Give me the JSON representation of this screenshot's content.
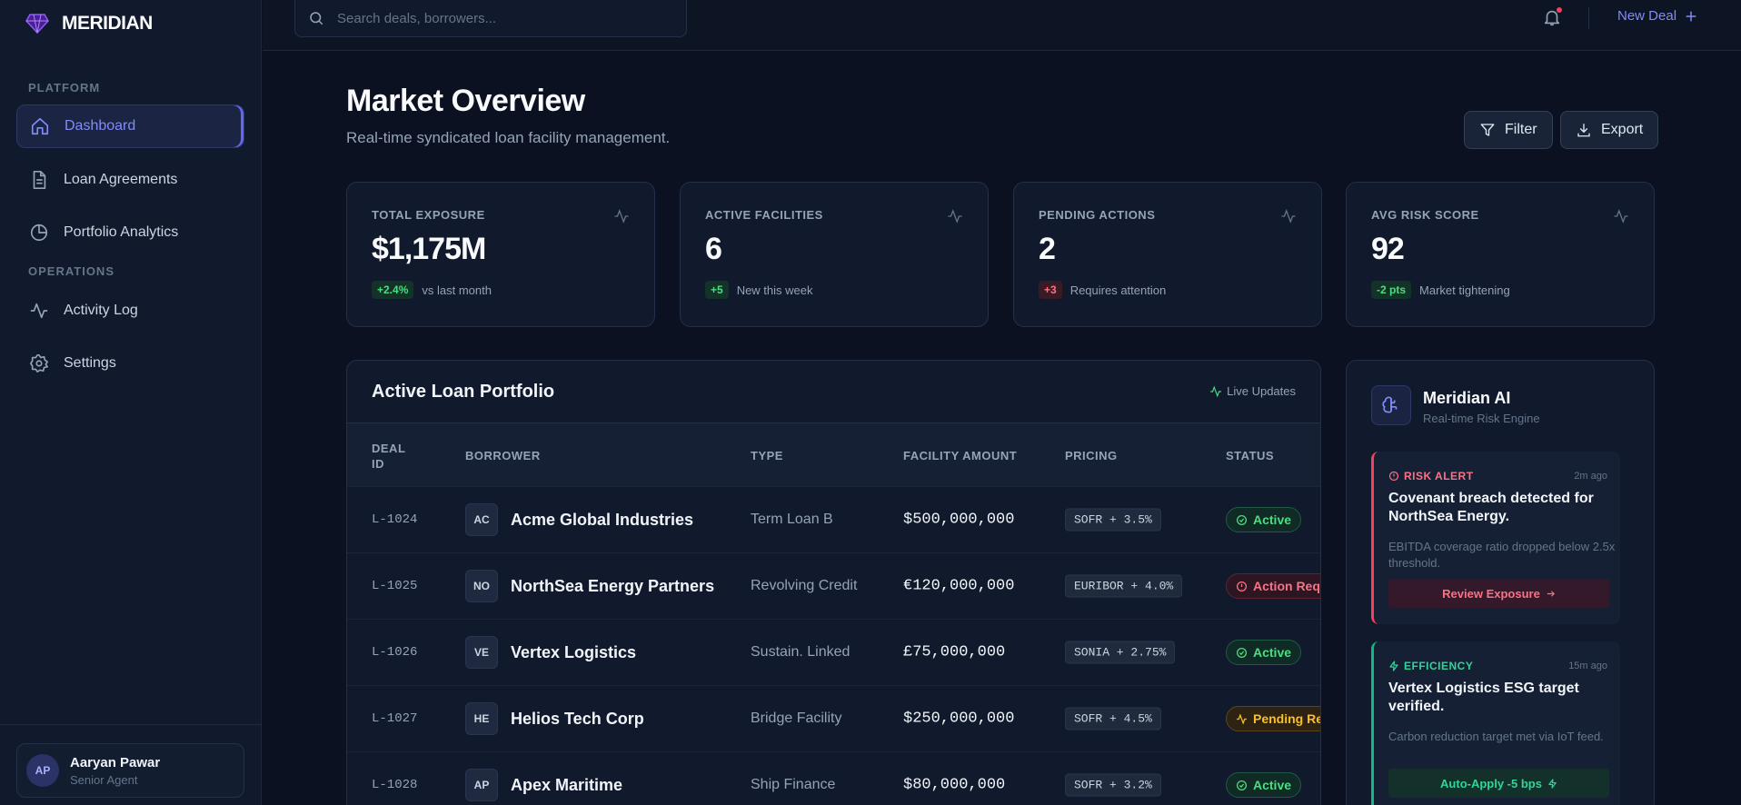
{
  "app": {
    "brand": "MERIDIAN"
  },
  "sidebar": {
    "sections": [
      "PLATFORM",
      "OPERATIONS"
    ],
    "items": [
      {
        "label": "Dashboard",
        "icon": "home-icon",
        "active": true
      },
      {
        "label": "Loan Agreements",
        "icon": "document-icon"
      },
      {
        "label": "Portfolio Analytics",
        "icon": "pie-chart-icon"
      },
      {
        "label": "Activity Log",
        "icon": "activity-icon"
      },
      {
        "label": "Settings",
        "icon": "gear-icon"
      }
    ],
    "user": {
      "initials": "AP",
      "name": "Aaryan Pawar",
      "role": "Senior Agent"
    }
  },
  "topbar": {
    "search_placeholder": "Search deals, borrowers...",
    "new_deal_label": "New Deal"
  },
  "header": {
    "title": "Market Overview",
    "subtitle": "Real-time syndicated loan facility management.",
    "filter_label": "Filter",
    "export_label": "Export"
  },
  "stats": [
    {
      "label": "TOTAL EXPOSURE",
      "value": "$1,175M",
      "delta": "+2.4%",
      "note": "vs last month",
      "tone": "green"
    },
    {
      "label": "ACTIVE FACILITIES",
      "value": "6",
      "delta": "+5",
      "note": "New this week",
      "tone": "green"
    },
    {
      "label": "PENDING ACTIONS",
      "value": "2",
      "delta": "+3",
      "note": "Requires attention",
      "tone": "red"
    },
    {
      "label": "AVG RISK SCORE",
      "value": "92",
      "delta": "-2 pts",
      "note": "Market tightening",
      "tone": "green"
    }
  ],
  "portfolio": {
    "title": "Active Loan Portfolio",
    "live_label": "Live Updates",
    "columns": {
      "deal_id_1": "DEAL",
      "deal_id_2": "ID",
      "borrower": "BORROWER",
      "type": "TYPE",
      "amount": "FACILITY AMOUNT",
      "pricing": "PRICING",
      "status": "STATUS"
    },
    "rows": [
      {
        "id": "L-1024",
        "initials": "AC",
        "borrower": "Acme Global Industries",
        "type": "Term Loan B",
        "amount": "$500,000,000",
        "pricing": "SOFR + 3.5%",
        "status": "Active",
        "status_kind": "active"
      },
      {
        "id": "L-1025",
        "initials": "NO",
        "borrower": "NorthSea Energy Partners",
        "type": "Revolving Credit",
        "amount": "€120,000,000",
        "pricing": "EURIBOR + 4.0%",
        "status": "Action Required",
        "status_kind": "alert"
      },
      {
        "id": "L-1026",
        "initials": "VE",
        "borrower": "Vertex Logistics",
        "type": "Sustain. Linked",
        "amount": "£75,000,000",
        "pricing": "SONIA + 2.75%",
        "status": "Active",
        "status_kind": "active"
      },
      {
        "id": "L-1027",
        "initials": "HE",
        "borrower": "Helios Tech Corp",
        "type": "Bridge Facility",
        "amount": "$250,000,000",
        "pricing": "SOFR + 4.5%",
        "status": "Pending Review",
        "status_kind": "pending"
      },
      {
        "id": "L-1028",
        "initials": "AP",
        "borrower": "Apex Maritime",
        "type": "Ship Finance",
        "amount": "$80,000,000",
        "pricing": "SOFR + 3.2%",
        "status": "Active",
        "status_kind": "active"
      }
    ]
  },
  "ai": {
    "title": "Meridian AI",
    "subtitle": "Real-time Risk Engine",
    "insights": [
      {
        "tag": "RISK ALERT",
        "time": "2m ago",
        "title": "Covenant breach detected for NorthSea Energy.",
        "body": "EBITDA coverage ratio dropped below 2.5x threshold.",
        "action": "Review Exposure"
      },
      {
        "tag": "EFFICIENCY",
        "time": "15m ago",
        "title": "Vertex Logistics ESG target verified.",
        "body": "Carbon reduction target met via IoT feed.",
        "action": "Auto-Apply -5 bps"
      }
    ]
  },
  "colors": {
    "accent": "#818cf8",
    "success": "#4ade80",
    "danger": "#fb7185",
    "warning": "#fbbf24",
    "background": "#0b1120"
  }
}
